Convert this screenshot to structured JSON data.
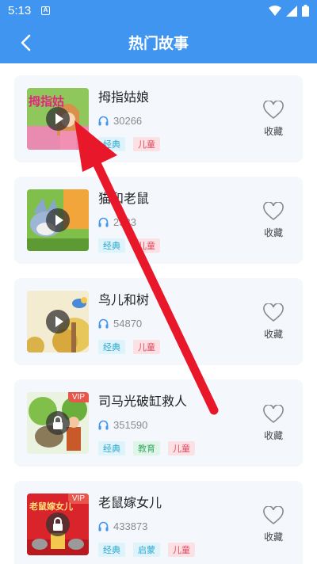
{
  "status": {
    "time": "5:13",
    "notif_letter": "A"
  },
  "header": {
    "title": "热门故事"
  },
  "stories": [
    {
      "title": "拇指姑娘",
      "plays": "30266",
      "vip": "",
      "tags": [
        "经典",
        "儿童"
      ],
      "fav_label": "收藏",
      "art_text": "拇指姑"
    },
    {
      "title": "猫和老鼠",
      "plays": "2533",
      "vip": "",
      "tags": [
        "经典",
        "儿童"
      ],
      "fav_label": "收藏",
      "art_text": ""
    },
    {
      "title": "鸟儿和树",
      "plays": "54870",
      "vip": "",
      "tags": [
        "经典",
        "儿童"
      ],
      "fav_label": "收藏",
      "art_text": ""
    },
    {
      "title": "司马光破缸救人",
      "plays": "351590",
      "vip": "VIP",
      "tags": [
        "经典",
        "教育",
        "儿童"
      ],
      "fav_label": "收藏",
      "art_text": ""
    },
    {
      "title": "老鼠嫁女儿",
      "plays": "433873",
      "vip": "VIP",
      "tags": [
        "经典",
        "启蒙",
        "儿童"
      ],
      "fav_label": "收藏",
      "art_text": "老鼠嫁女儿"
    }
  ],
  "colors": {
    "primary": "#3f95ef",
    "card_bg": "#f4f8fd",
    "arrow": "#e8182a"
  }
}
